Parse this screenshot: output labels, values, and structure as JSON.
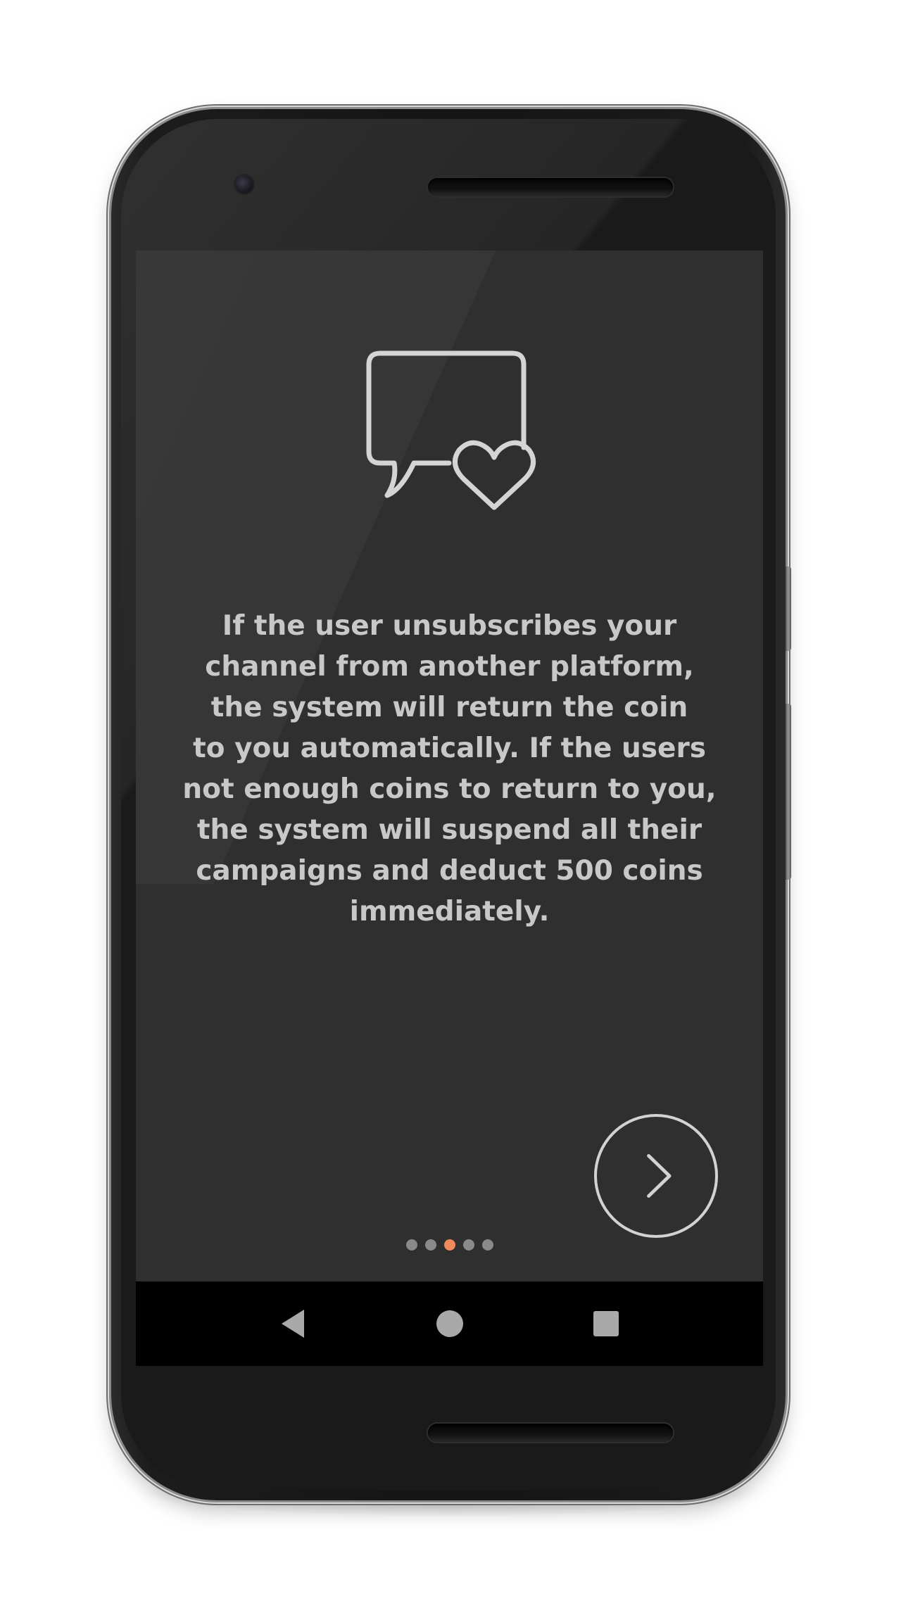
{
  "app": {
    "message": "If the user unsubscribes your\nchannel from another platform,\nthe system will return the coin\nto you automatically. If the users\nnot enough coins to return to you,\nthe system will suspend all their\ncampaigns and deduct 500 coins\nimmediately.",
    "hero_icon": "chat-bubble-heart-icon",
    "next_icon": "chevron-right-icon",
    "pager": {
      "total_pages": 5,
      "current_page": 3
    }
  },
  "system_nav": {
    "back_icon": "back-triangle-icon",
    "home_icon": "home-circle-icon",
    "recents_icon": "recents-square-icon"
  },
  "colors": {
    "screen_background": "#2f2f2f",
    "text": "#c8c8c8",
    "icon_stroke": "#d4d4d4",
    "dot_inactive": "#8a8a8a",
    "dot_active": "#f08a5d",
    "nav_bar": "#000000",
    "nav_icon": "#a9a9a9"
  }
}
